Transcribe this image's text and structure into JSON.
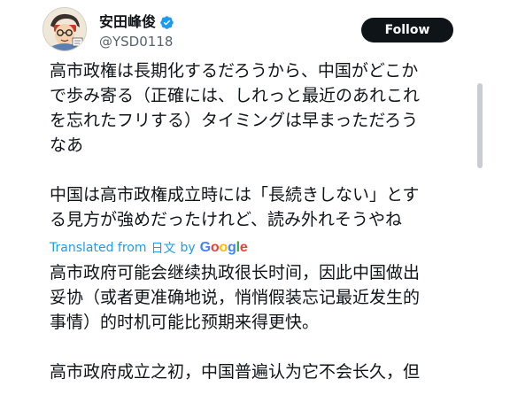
{
  "author": {
    "display_name": "安田峰俊",
    "handle": "@YSD0118",
    "verified": true,
    "verified_color": "#1d9bf0"
  },
  "actions": {
    "follow_label": "Follow"
  },
  "tweet": {
    "original_paragraphs": [
      "高市政権は長期化するだろうから、中国がどこか\nで歩み寄る（正確には、しれっと最近のあれこれ\nを忘れたフリする）タイミングは早まっただろう\nなあ",
      "中国は高市政権成立時には「長続きしない」とす\nる見方が強めだったけれど、読み外れそうやね"
    ],
    "translation": {
      "label": "Translated from",
      "language": "日文",
      "by": "by",
      "provider": "Google",
      "provider_letters": [
        "G",
        "o",
        "o",
        "g",
        "l",
        "e"
      ],
      "provider_colors": [
        "#4285f4",
        "#ea4335",
        "#fbbc05",
        "#4285f4",
        "#34a853",
        "#ea4335"
      ],
      "link_color": "#1d9bf0"
    },
    "translated_paragraphs": [
      "高市政府可能会继续执政很长时间，因此中国做出\n妥协（或者更准确地说，悄悄假装忘记最近发生的\n事情）的时机可能比预期来得更快。",
      "高市政府成立之初，中国普遍认为它不会长久，但"
    ]
  }
}
